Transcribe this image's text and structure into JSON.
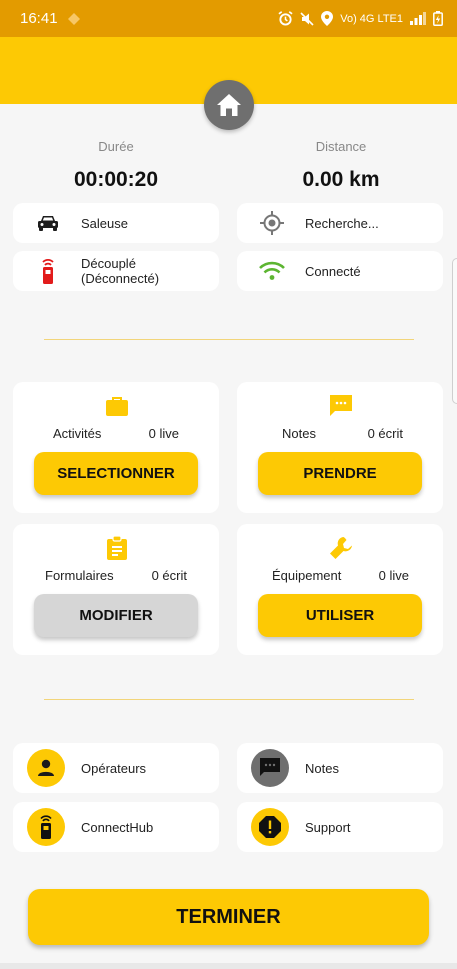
{
  "status_bar": {
    "time": "16:41",
    "network_label": "Vo) 4G LTE1",
    "bg_color": "#e39b00"
  },
  "colors": {
    "accent": "#fdc904",
    "grey_button": "#d6d6d6",
    "home_fab": "#6f6f6f",
    "wifi_green": "#5cb531",
    "device_red": "#e21b1b"
  },
  "metrics": {
    "duration": {
      "label": "Durée",
      "value": "00:00:20"
    },
    "distance": {
      "label": "Distance",
      "value": "0.00 km"
    }
  },
  "status_pills": {
    "vehicle": {
      "label": "Saleuse",
      "icon": "car-icon"
    },
    "gps": {
      "label": "Recherche...",
      "icon": "gps-target-icon"
    },
    "device": {
      "label_line1": "Découplé",
      "label_line2": "(Déconnecté)",
      "icon": "remote-device-icon"
    },
    "network": {
      "label": "Connecté",
      "icon": "wifi-icon"
    }
  },
  "cards": {
    "activities": {
      "label": "Activités",
      "count": "0 live",
      "button": "SELECTIONNER",
      "icon": "briefcase-icon"
    },
    "notes": {
      "label": "Notes",
      "count": "0 écrit",
      "button": "PRENDRE",
      "icon": "chat-icon"
    },
    "forms": {
      "label": "Formulaires",
      "count": "0 écrit",
      "button": "MODIFIER",
      "icon": "clipboard-icon"
    },
    "equipment": {
      "label": "Équipement",
      "count": "0 live",
      "button": "UTILISER",
      "icon": "wrench-icon"
    }
  },
  "bottom_links": {
    "operators": {
      "label": "Opérateurs",
      "icon": "person-icon"
    },
    "notes": {
      "label": "Notes",
      "icon": "message-icon"
    },
    "connecthub": {
      "label": "ConnectHub",
      "icon": "device-icon"
    },
    "support": {
      "label": "Support",
      "icon": "alert-icon"
    }
  },
  "finish_button": {
    "label": "TERMINER"
  }
}
